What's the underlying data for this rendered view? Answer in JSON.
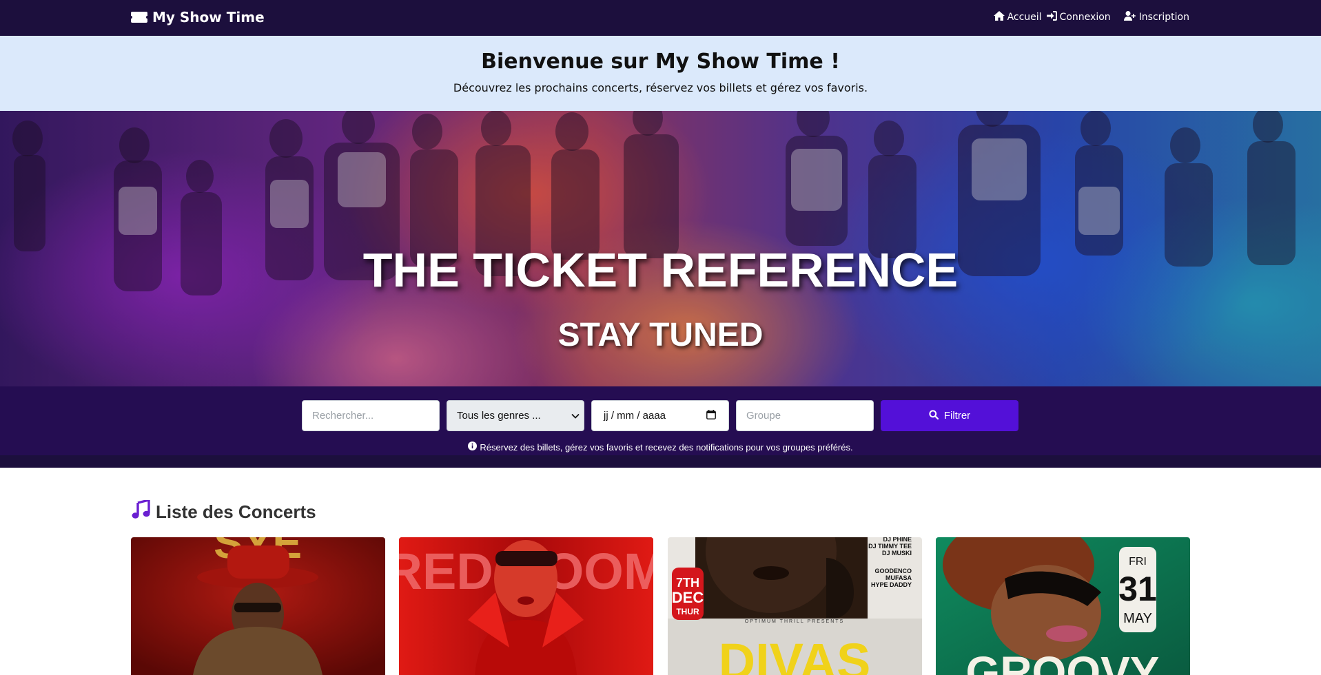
{
  "navbar": {
    "brand": "My Show Time",
    "brand_icon": "ticket-icon",
    "links": [
      {
        "label": "Accueil",
        "icon": "home-icon"
      },
      {
        "label": "Connexion",
        "icon": "sign-in-icon"
      },
      {
        "label": "Inscription",
        "icon": "user-plus-icon"
      }
    ]
  },
  "welcome": {
    "title": "Bienvenue sur My Show Time !",
    "subtitle": "Découvrez les prochains concerts, réservez vos billets et gérez vos favoris."
  },
  "hero": {
    "title": "THE TICKET REFERENCE",
    "subtitle": "STAY TUNED"
  },
  "filters": {
    "search_placeholder": "Rechercher...",
    "genre_selected": "Tous les genres ...",
    "date_value": "jj / mm / aaaa",
    "group_placeholder": "Groupe",
    "filter_button": "Filtrer",
    "info": "Réservez des billets, gérez vos favoris et recevez des notifications pour vos groupes préférés."
  },
  "concerts": {
    "title": "Liste des Concerts",
    "title_icon": "music-icon",
    "cards": [
      {
        "poster_text": "SYE"
      },
      {
        "poster_text": "RED ROOM"
      },
      {
        "poster_text": "DIVAS",
        "date_day": "7TH",
        "date_month": "DEC",
        "date_weekday": "THUR",
        "presenter": "OPTIMUM THRILL PRESENTS",
        "lineup": [
          "DJ PHINE",
          "DJ TIMMY TEE",
          "DJ MUSKI",
          "GOODENCO",
          "MUFASA",
          "HYPE DADDY"
        ]
      },
      {
        "poster_text": "GROOVY",
        "date_weekday": "FRI",
        "date_day": "31",
        "date_month": "MAY"
      }
    ]
  },
  "colors": {
    "navbar": "#1c0f3d",
    "welcome_bg": "#dbe9fb",
    "filter_bg": "#250d52",
    "filter_button": "#5310d8",
    "music_icon": "#6a1fd1"
  }
}
